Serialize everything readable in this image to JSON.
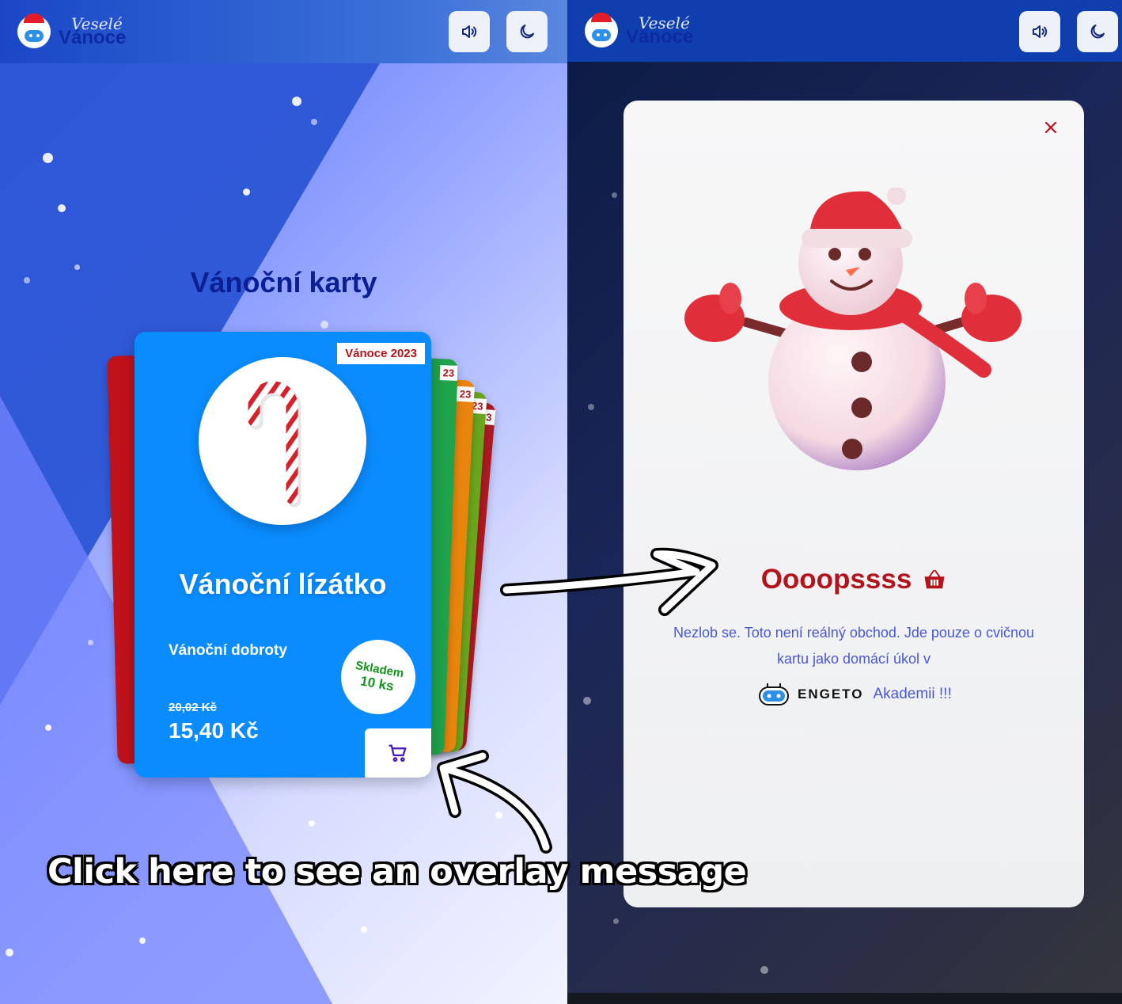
{
  "header": {
    "logo_small": "Veselé",
    "logo_big": "Vánoce"
  },
  "left": {
    "section_title": "Vánoční karty",
    "card": {
      "tag": "Vánoce 2023",
      "name": "Vánoční lízátko",
      "category": "Vánoční dobroty",
      "stock_label": "Skladem",
      "stock_count": "10 ks",
      "old_price": "20,02 Kč",
      "price": "15,40 Kč"
    },
    "back_card_tag": "23"
  },
  "modal": {
    "title": "Oooopssss",
    "message": "Nezlob se. Toto není reálný obchod. Jde pouze o cvičnou kartu jako domácí úkol v",
    "engeto_wordmark": "ENGETO",
    "academy_text": "Akademii !!!"
  },
  "caption": "Click here to see an overlay message",
  "colors": {
    "card_blue": "#0a8cff",
    "accent_red": "#b3141c",
    "header_blue": "#1a47c7",
    "link_blue": "#4a58d6"
  },
  "icons": [
    "speaker-icon",
    "moon-icon",
    "close-icon",
    "cart-icon",
    "basket-icon",
    "candy-cane-icon",
    "snowman-icon",
    "engeto-bot-icon"
  ]
}
